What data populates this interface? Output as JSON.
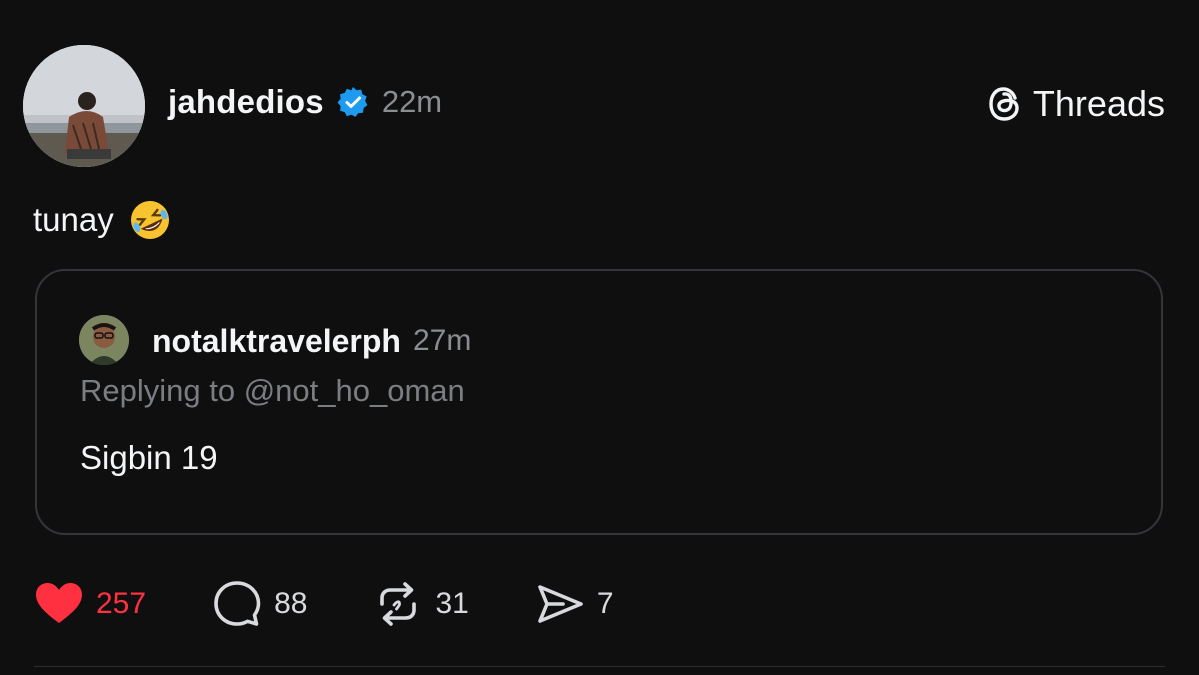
{
  "post": {
    "author": "jahdedios",
    "time": "22m",
    "text": "tunay",
    "emoji_icon": "rolling-on-floor-laughing-emoji",
    "verified_icon": "verified-badge-icon"
  },
  "brand": {
    "label": "Threads",
    "icon": "threads-logo-icon"
  },
  "quote": {
    "author": "notalktravelerph",
    "time": "27m",
    "replying": "Replying to @not_ho_oman",
    "text": "Sigbin 19"
  },
  "actions": {
    "likes": "257",
    "replies": "88",
    "reposts": "31",
    "shares": "7"
  },
  "colors": {
    "background": "#0f0f10",
    "like": "#ff3040",
    "verified": "#1d9bf0",
    "muted": "#8a8d91"
  }
}
